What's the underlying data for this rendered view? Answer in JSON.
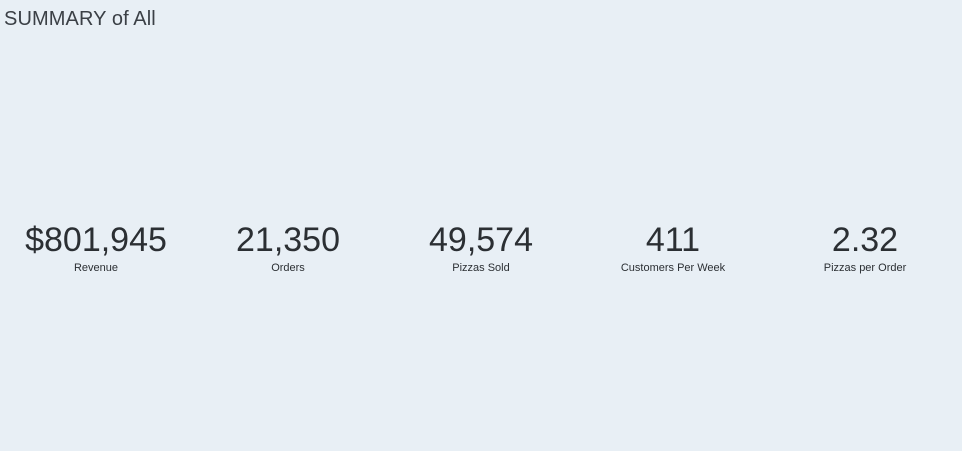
{
  "dashboard": {
    "title": "SUMMARY of All"
  },
  "kpis": [
    {
      "value": "$801,945",
      "label": "Revenue"
    },
    {
      "value": "21,350",
      "label": "Orders"
    },
    {
      "value": "49,574",
      "label": "Pizzas Sold"
    },
    {
      "value": "411",
      "label": "Customers Per Week"
    },
    {
      "value": "2.32",
      "label": "Pizzas per Order"
    }
  ],
  "colors": {
    "background": "#e8eff5",
    "text": "#2b2f33"
  }
}
